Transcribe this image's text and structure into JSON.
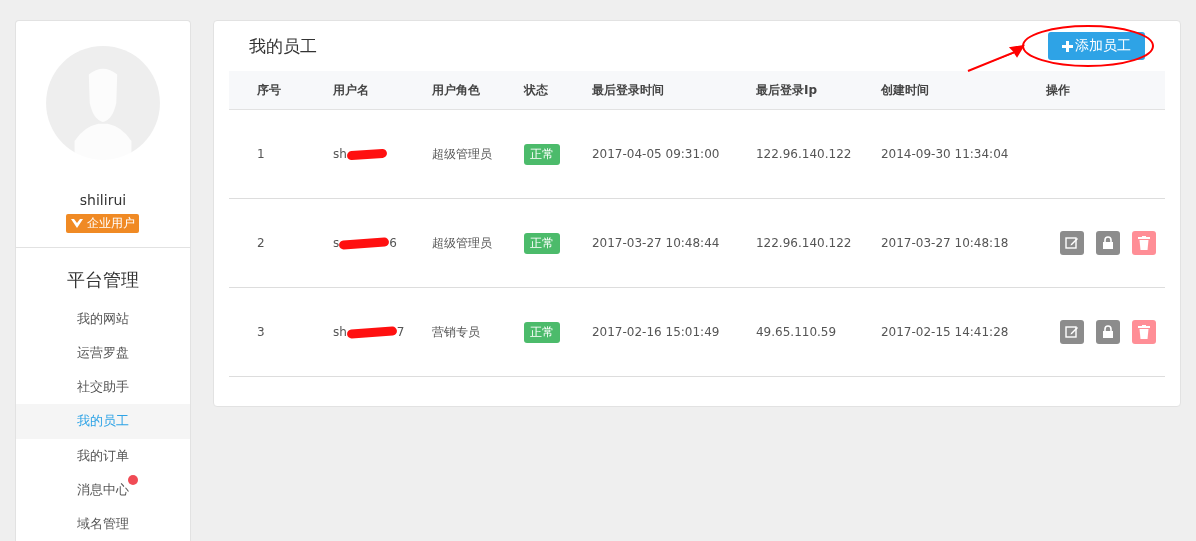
{
  "profile": {
    "name": "shilirui",
    "badge": "企业用户"
  },
  "sidebar": {
    "title": "平台管理",
    "items": [
      {
        "label": "我的网站",
        "selected": false,
        "dot": false
      },
      {
        "label": "运营罗盘",
        "selected": false,
        "dot": false
      },
      {
        "label": "社交助手",
        "selected": false,
        "dot": false
      },
      {
        "label": "我的员工",
        "selected": true,
        "dot": false
      },
      {
        "label": "我的订单",
        "selected": false,
        "dot": false
      },
      {
        "label": "消息中心",
        "selected": false,
        "dot": true
      },
      {
        "label": "域名管理",
        "selected": false,
        "dot": false
      }
    ]
  },
  "panel": {
    "title": "我的员工",
    "add_button": {
      "label": "添加员工",
      "annotated": true
    }
  },
  "table": {
    "columns": [
      "序号",
      "用户名",
      "用户角色",
      "状态",
      "最后登录时间",
      "最后登录Ip",
      "创建时间",
      "操作"
    ],
    "rows": [
      {
        "index": "1",
        "username_start": "sh",
        "username_end": "",
        "redacted": true,
        "role": "超级管理员",
        "status": "正常",
        "last_login": "2017-04-05 09:31:00",
        "ip": "122.96.140.122",
        "created": "2014-09-30 11:34:04",
        "actions": []
      },
      {
        "index": "2",
        "username_start": "s",
        "username_end": "6",
        "redacted": true,
        "role": "超级管理员",
        "status": "正常",
        "last_login": "2017-03-27 10:48:44",
        "ip": "122.96.140.122",
        "created": "2017-03-27 10:48:18",
        "actions": [
          {
            "kind": "edit"
          },
          {
            "kind": "lock"
          },
          {
            "kind": "delete"
          }
        ]
      },
      {
        "index": "3",
        "username_start": "sh",
        "username_end": "7",
        "redacted": true,
        "role": "营销专员",
        "status": "正常",
        "last_login": "2017-02-16 15:01:49",
        "ip": "49.65.110.59",
        "created": "2017-02-15 14:41:28",
        "actions": [
          {
            "kind": "edit"
          },
          {
            "kind": "lock"
          },
          {
            "kind": "delete"
          }
        ]
      }
    ]
  }
}
